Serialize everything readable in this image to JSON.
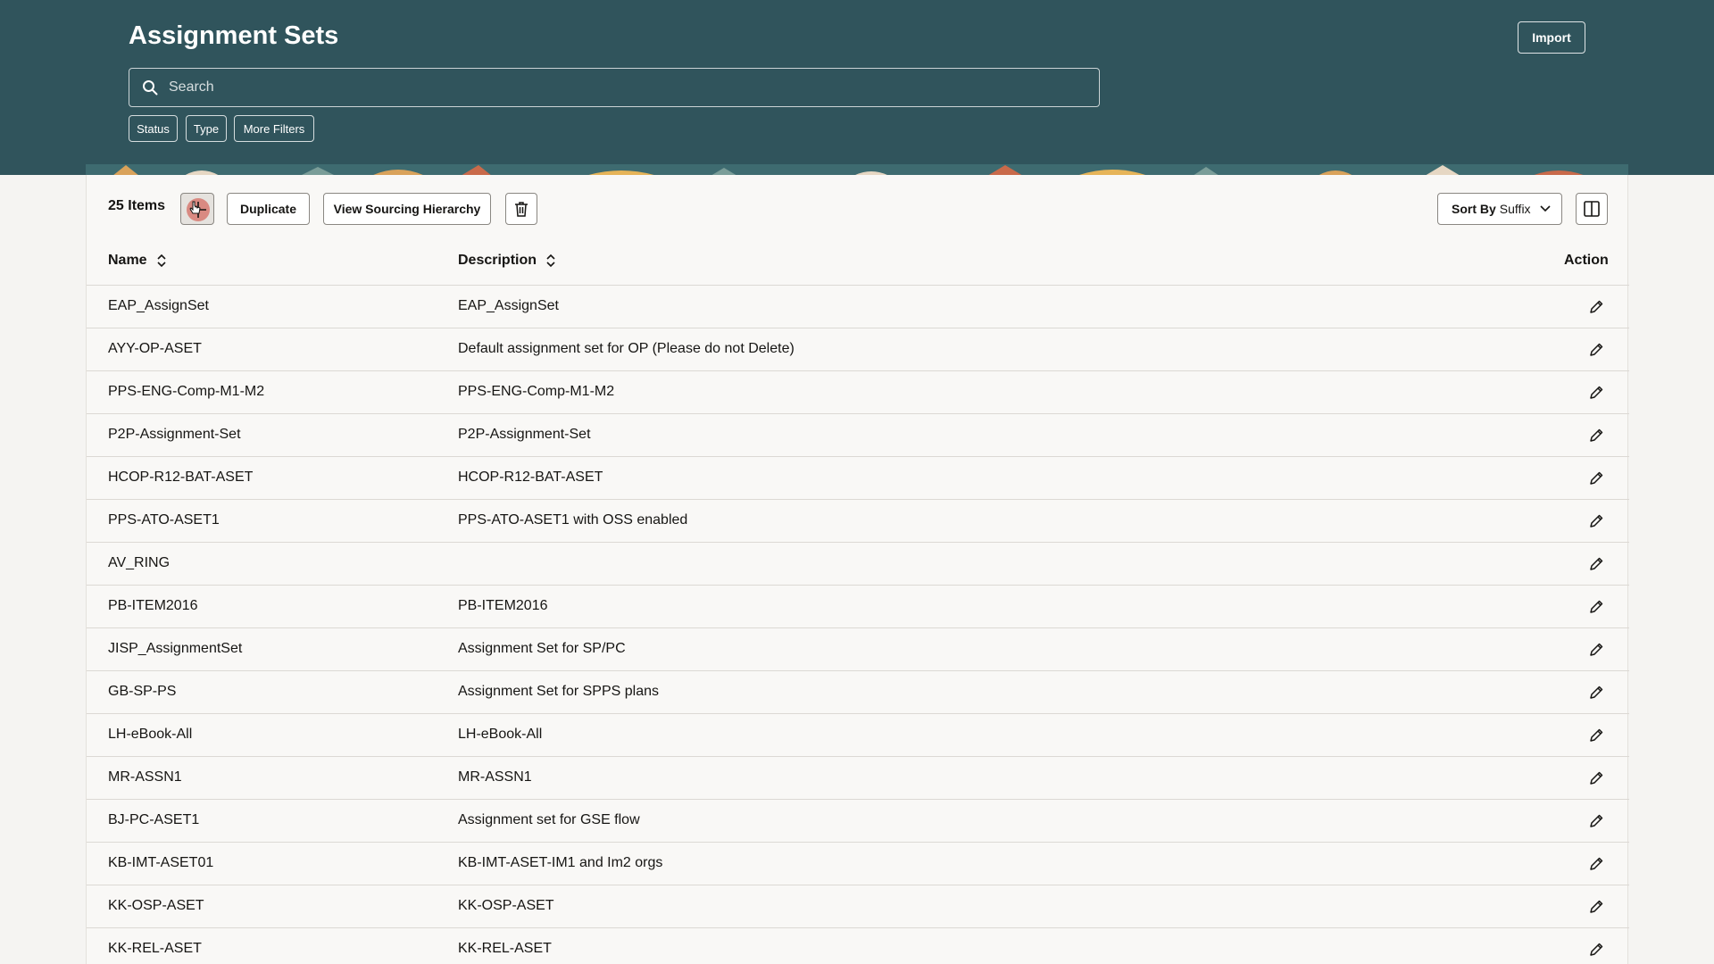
{
  "header": {
    "title": "Assignment Sets",
    "import_label": "Import",
    "search": {
      "placeholder": "Search",
      "value": ""
    },
    "filters": [
      "Status",
      "Type",
      "More Filters"
    ]
  },
  "toolbar": {
    "count_label": "25 Items",
    "duplicate_label": "Duplicate",
    "view_hierarchy_label": "View Sourcing Hierarchy",
    "sort_label": "Sort By",
    "sort_value": "Suffix"
  },
  "table": {
    "columns": {
      "name": "Name",
      "description": "Description",
      "action": "Action"
    },
    "rows": [
      {
        "name": "EAP_AssignSet",
        "description": "EAP_AssignSet"
      },
      {
        "name": "AYY-OP-ASET",
        "description": "Default assignment set for OP (Please do not Delete)"
      },
      {
        "name": "PPS-ENG-Comp-M1-M2",
        "description": "PPS-ENG-Comp-M1-M2"
      },
      {
        "name": "P2P-Assignment-Set",
        "description": "P2P-Assignment-Set"
      },
      {
        "name": "HCOP-R12-BAT-ASET",
        "description": "HCOP-R12-BAT-ASET"
      },
      {
        "name": "PPS-ATO-ASET1",
        "description": "PPS-ATO-ASET1 with OSS enabled"
      },
      {
        "name": "AV_RING",
        "description": ""
      },
      {
        "name": "PB-ITEM2016",
        "description": "PB-ITEM2016"
      },
      {
        "name": "JISP_AssignmentSet",
        "description": "Assignment Set for SP/PC"
      },
      {
        "name": "GB-SP-PS",
        "description": "Assignment Set for SPPS plans"
      },
      {
        "name": "LH-eBook-All",
        "description": "LH-eBook-All"
      },
      {
        "name": "MR-ASSN1",
        "description": "MR-ASSN1"
      },
      {
        "name": "BJ-PC-ASET1",
        "description": "Assignment set for GSE flow"
      },
      {
        "name": "KB-IMT-ASET01",
        "description": "KB-IMT-ASET-IM1 and Im2 orgs"
      },
      {
        "name": "KK-OSP-ASET",
        "description": "KK-OSP-ASET"
      },
      {
        "name": "KK-REL-ASET",
        "description": "KK-REL-ASET"
      }
    ]
  },
  "colors": {
    "header_bg": "#30545c",
    "add_highlight": "#d98a82"
  },
  "icons": [
    "search-icon",
    "plus-icon",
    "cursor-icon",
    "trash-icon",
    "chevron-down-icon",
    "columns-icon",
    "sort-icon",
    "pencil-icon"
  ]
}
